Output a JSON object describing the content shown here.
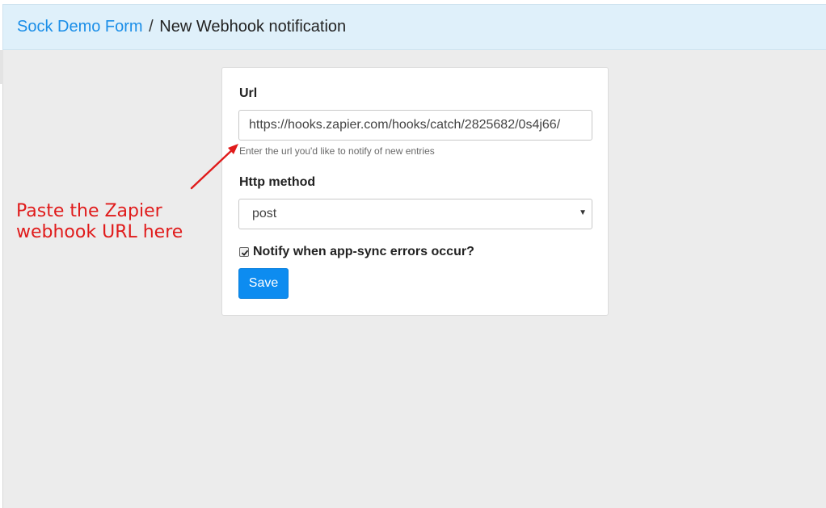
{
  "header": {
    "breadcrumb_link": "Sock Demo Form",
    "breadcrumb_separator": "/",
    "page_title": "New Webhook notification"
  },
  "form": {
    "url_label": "Url",
    "url_value": "https://hooks.zapier.com/hooks/catch/2825682/0s4j66/",
    "url_help": "Enter the url you'd like to notify of new entries",
    "method_label": "Http method",
    "method_value": "post",
    "notify_label": "Notify when app-sync errors occur?",
    "notify_checked": true,
    "save_label": "Save"
  },
  "annotation": {
    "line1": "Paste the Zapier",
    "line2": "webhook URL here",
    "color": "#e01b1b"
  },
  "colors": {
    "header_bg": "#dff0fa",
    "link": "#1a8ee8",
    "primary_button": "#0d8cf0",
    "content_bg": "#ececec"
  }
}
